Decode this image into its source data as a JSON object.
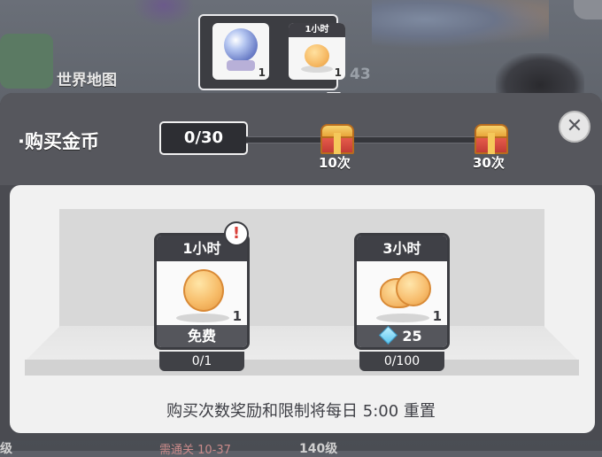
{
  "background": {
    "map_label": "世界地图",
    "map_number": "43",
    "bottom_left_text": "级",
    "bottom_text": "需通关 10-37",
    "bottom_level": "140级"
  },
  "tooltip": {
    "items": [
      {
        "name": "crystal-ball",
        "count": "1"
      },
      {
        "header": "1小时",
        "name": "gold-coin",
        "count": "1"
      }
    ]
  },
  "panel": {
    "title": "·购买金币",
    "close_icon": "close-icon",
    "progress": {
      "current": 0,
      "max": 30,
      "label": "0/30"
    },
    "milestones": [
      {
        "label": "10次",
        "icon": "chest-icon"
      },
      {
        "label": "30次",
        "icon": "chest-icon"
      }
    ]
  },
  "offers": [
    {
      "duration": "1小时",
      "count": "1",
      "price": "免费",
      "limit": "0/1",
      "alert": "!"
    },
    {
      "duration": "3小时",
      "count": "1",
      "price": "25",
      "price_icon": "gem-icon",
      "limit": "0/100"
    }
  ],
  "footer_note": "购买次数奖励和限制将每日 5:00 重置"
}
